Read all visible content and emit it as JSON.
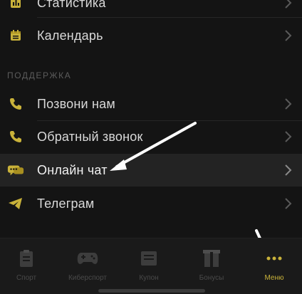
{
  "menu": {
    "items_top": [
      {
        "label": "Статистика",
        "icon": "statistics-icon"
      },
      {
        "label": "Календарь",
        "icon": "calendar-icon"
      }
    ],
    "section_title": "ПОДДЕРЖКА",
    "support_items": [
      {
        "label": "Позвони нам",
        "icon": "phone-icon"
      },
      {
        "label": "Обратный звонок",
        "icon": "phone-icon"
      },
      {
        "label": "Онлайн чат",
        "icon": "chat-icon"
      },
      {
        "label": "Телеграм",
        "icon": "telegram-icon"
      }
    ]
  },
  "tabbar": {
    "tabs": [
      {
        "label": "Спорт",
        "icon": "clipboard-icon"
      },
      {
        "label": "Киберспорт",
        "icon": "gamepad-icon"
      },
      {
        "label": "Купон",
        "icon": "coupon-icon"
      },
      {
        "label": "Бонусы",
        "icon": "gift-icon"
      },
      {
        "label": "Меню",
        "icon": "more-dots-icon",
        "active": true
      }
    ]
  },
  "colors": {
    "accent": "#c9b23a",
    "background": "#141414",
    "highlight_row": "#232323"
  }
}
